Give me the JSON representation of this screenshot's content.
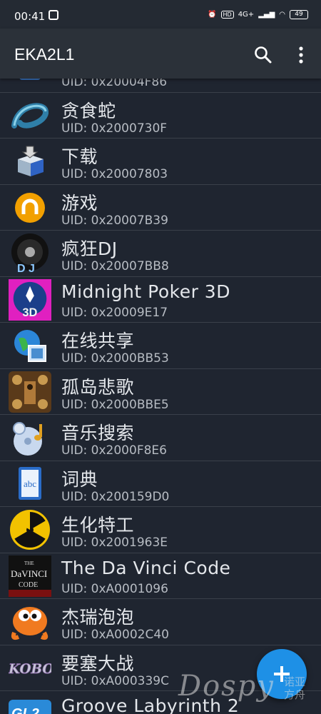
{
  "status_bar": {
    "time": "00:41",
    "network": "4G+",
    "battery": "49"
  },
  "app_bar": {
    "title": "EKA2L1",
    "search_icon": "search-icon",
    "menu_icon": "more-vert-icon"
  },
  "apps": [
    {
      "name": "",
      "uid": "UID: 0x20004F86"
    },
    {
      "name": "贪食蛇",
      "uid": "UID: 0x2000730F"
    },
    {
      "name": "下载",
      "uid": "UID: 0x20007803"
    },
    {
      "name": "游戏",
      "uid": "UID: 0x20007B39"
    },
    {
      "name": "疯狂DJ",
      "uid": "UID: 0x20007BB8"
    },
    {
      "name": "Midnight Poker 3D",
      "uid": "UID: 0x20009E17"
    },
    {
      "name": "在线共享",
      "uid": "UID: 0x2000BB53"
    },
    {
      "name": "孤岛悲歌",
      "uid": "UID: 0x2000BBE5"
    },
    {
      "name": "音乐搜索",
      "uid": "UID: 0x2000F8E6"
    },
    {
      "name": "词典",
      "uid": "UID: 0x200159D0"
    },
    {
      "name": "生化特工",
      "uid": "UID: 0x2001963E"
    },
    {
      "name": "The Da Vinci Code",
      "uid": "UID: 0xA0001096"
    },
    {
      "name": "杰瑞泡泡",
      "uid": "UID: 0xA0002C40"
    },
    {
      "name": "要塞大战",
      "uid": "UID: 0xA000339C"
    },
    {
      "name": "Groove Labyrinth 2",
      "uid": ""
    }
  ],
  "fab": {
    "label": "+"
  },
  "watermark": {
    "text": "Dospy",
    "sub": "诺亚方舟"
  },
  "colors": {
    "background": "#1f2530",
    "app_bar": "#2b3139",
    "fab": "#1e90e6"
  }
}
